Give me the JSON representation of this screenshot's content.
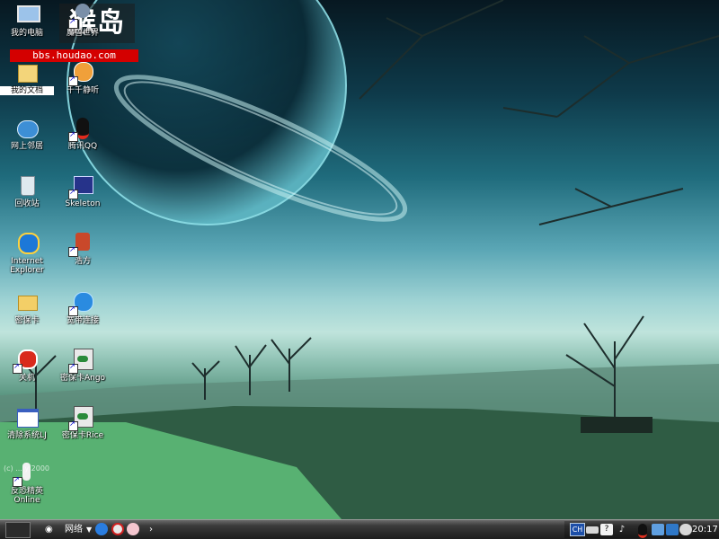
{
  "watermark": {
    "brand": "猴岛",
    "url": "bbs.houdao.com"
  },
  "desktop_icons": [
    {
      "label": "我的电脑",
      "icon": "my-computer-icon"
    },
    {
      "label": "魔兽世界",
      "icon": "wow-icon"
    },
    {
      "label": "我的文档",
      "icon": "my-documents-icon",
      "selected": true
    },
    {
      "label": "千千静听",
      "icon": "ttplayer-icon"
    },
    {
      "label": "网上邻居",
      "icon": "network-places-icon"
    },
    {
      "label": "腾讯QQ",
      "icon": "qq-penguin-icon"
    },
    {
      "label": "回收站",
      "icon": "recycle-bin-icon"
    },
    {
      "label": "Skeleton",
      "icon": "skeleton-app-icon"
    },
    {
      "label": "Internet Explorer",
      "icon": "internet-explorer-icon"
    },
    {
      "label": "浩方",
      "icon": "haofang-icon"
    },
    {
      "label": "密保卡",
      "icon": "folder-icon"
    },
    {
      "label": "宽带连接",
      "icon": "broadband-connection-icon"
    },
    {
      "label": "关机",
      "icon": "shutdown-icon"
    },
    {
      "label": "密保卡Ango",
      "icon": "exe-eye-icon"
    },
    {
      "label": "清除系统LJ",
      "icon": "cleaner-app-icon"
    },
    {
      "label": "密保卡Rice",
      "icon": "exe-eye-icon"
    },
    {
      "label": "反恐精英 Online",
      "icon": "counter-strike-icon"
    }
  ],
  "copyright_text": "(c) ... y 2000",
  "taskbar": {
    "toolbar_label": "网络",
    "quicklaunch": [
      "ie-quicklaunch-icon",
      "music-quicklaunch-icon",
      "pig-quicklaunch-icon"
    ],
    "overflow": "›",
    "tray": {
      "language": "CH",
      "clock": "20:17"
    }
  },
  "colors": {
    "selection": "#ffffff",
    "watermark_red": "#d40000",
    "taskbar": "#1e1e1e"
  }
}
